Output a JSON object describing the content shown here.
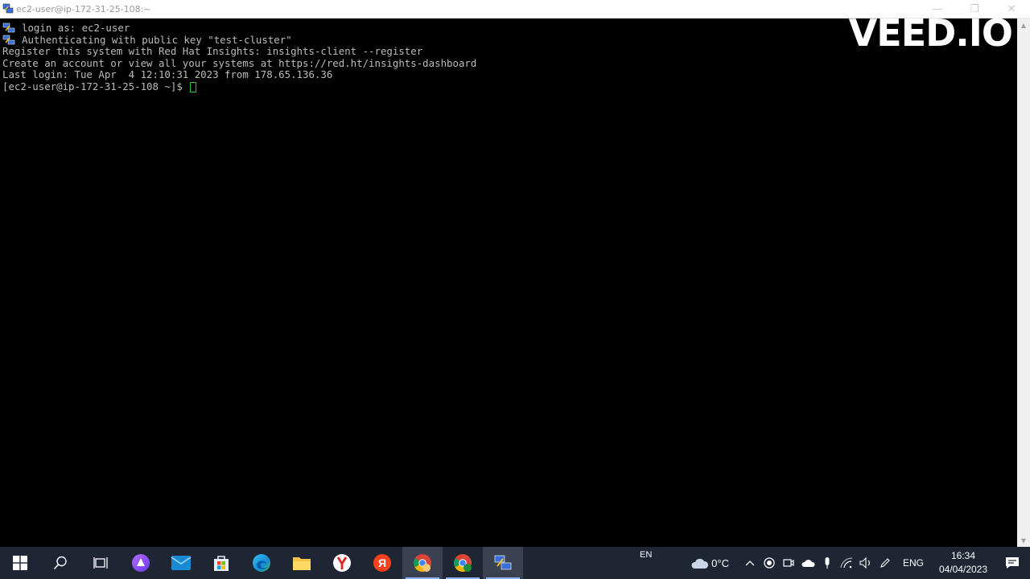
{
  "window": {
    "title": "ec2-user@ip-172-31-25-108:~",
    "minimize_label": "—",
    "restore_label": "❐",
    "close_label": "✕"
  },
  "terminal": {
    "lines": [
      {
        "icon": true,
        "text": "login as: ec2-user"
      },
      {
        "icon": true,
        "text": "Authenticating with public key \"test-cluster\""
      },
      {
        "icon": false,
        "text": "Register this system with Red Hat Insights: insights-client --register"
      },
      {
        "icon": false,
        "text": "Create an account or view all your systems at https://red.ht/insights-dashboard"
      },
      {
        "icon": false,
        "text": "Last login: Tue Apr  4 12:10:31 2023 from 178.65.136.36"
      },
      {
        "icon": false,
        "text": "[ec2-user@ip-172-31-25-108 ~]$ "
      }
    ],
    "text_color": "#bbbbbb",
    "cursor_color": "#30c830"
  },
  "watermark": "VEED.IO",
  "taskbar": {
    "items": [
      {
        "name": "start-button",
        "icon": "windows-icon"
      },
      {
        "name": "search-button",
        "icon": "search-icon"
      },
      {
        "name": "task-view-button",
        "icon": "task-view-icon"
      },
      {
        "name": "alice-button",
        "icon": "alice-icon"
      },
      {
        "name": "mail-button",
        "icon": "mail-icon"
      },
      {
        "name": "store-button",
        "icon": "store-icon"
      },
      {
        "name": "edge-button",
        "icon": "edge-icon"
      },
      {
        "name": "file-explorer-button",
        "icon": "folder-icon"
      },
      {
        "name": "yandex-browser-button",
        "icon": "yandex-browser-icon"
      },
      {
        "name": "yandex-button",
        "icon": "yandex-icon",
        "glyph": "Я"
      },
      {
        "name": "chrome-profile-button",
        "icon": "chrome-icon"
      },
      {
        "name": "chrome-m-button",
        "icon": "chrome-icon"
      },
      {
        "name": "putty-button",
        "icon": "putty-icon"
      }
    ],
    "input_language_short": "EN",
    "weather_temp": "0°C",
    "language": "ENG",
    "time": "16:34",
    "date": "04/04/2023"
  }
}
